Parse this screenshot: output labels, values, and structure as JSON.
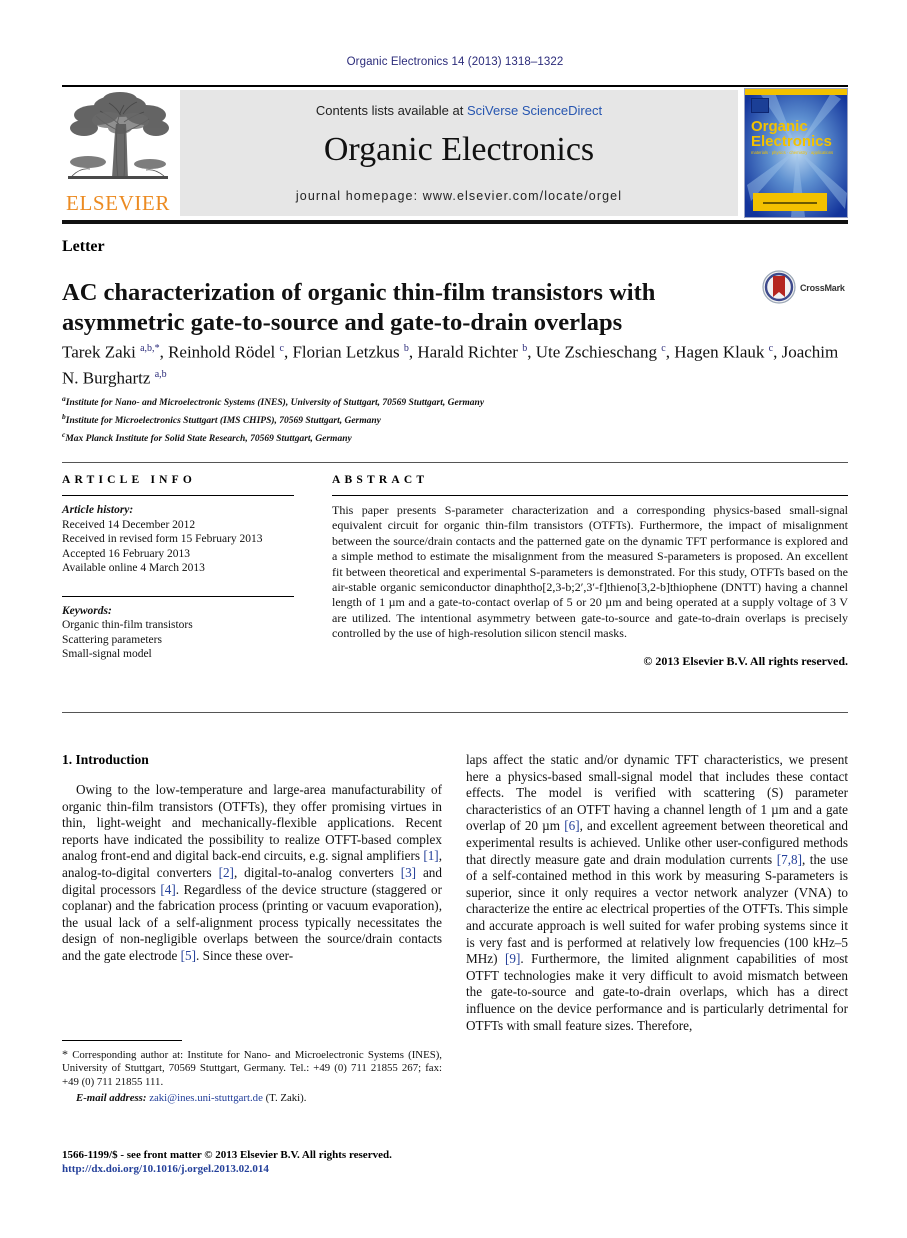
{
  "running_head": "Organic Electronics 14 (2013) 1318–1322",
  "masthead": {
    "contents_prefix": "Contents lists available at ",
    "sciencedirect_link": "SciVerse ScienceDirect",
    "journal_title": "Organic Electronics",
    "homepage_label": "journal homepage: www.elsevier.com/locate/orgel",
    "publisher_wordmark": "ELSEVIER",
    "cover": {
      "line1": "Organic",
      "line2": "Electronics",
      "tagline": "materials · physics · chemistry · applications"
    }
  },
  "article": {
    "doctype": "Letter",
    "title": "AC characterization of organic thin-film transistors with asymmetric gate-to-source and gate-to-drain overlaps",
    "crossmark_label": "CrossMark",
    "authors_html": "Tarek Zaki <sup>a,b,</sup><sup>*</sup>, Reinhold Rödel <sup>c</sup>, Florian Letzkus <sup>b</sup>, Harald Richter <sup>b</sup>, Ute Zschieschang <sup>c</sup>, Hagen Klauk <sup>c</sup>, Joachim N. Burghartz <sup>a,b</sup>",
    "affiliations": [
      {
        "marker": "a",
        "text": "Institute for Nano- and Microelectronic Systems (INES), University of Stuttgart, 70569 Stuttgart, Germany"
      },
      {
        "marker": "b",
        "text": "Institute for Microelectronics Stuttgart (IMS CHIPS), 70569 Stuttgart, Germany"
      },
      {
        "marker": "c",
        "text": "Max Planck Institute for Solid State Research, 70569 Stuttgart, Germany"
      }
    ]
  },
  "article_info": {
    "heading": "ARTICLE INFO",
    "history_label": "Article history:",
    "history": [
      "Received 14 December 2012",
      "Received in revised form 15 February 2013",
      "Accepted 16 February 2013",
      "Available online 4 March 2013"
    ],
    "keywords_label": "Keywords:",
    "keywords": [
      "Organic thin-film transistors",
      "Scattering parameters",
      "Small-signal model"
    ]
  },
  "abstract": {
    "heading": "ABSTRACT",
    "text": "This paper presents S-parameter characterization and a corresponding physics-based small-signal equivalent circuit for organic thin-film transistors (OTFTs). Furthermore, the impact of misalignment between the source/drain contacts and the patterned gate on the dynamic TFT performance is explored and a simple method to estimate the misalignment from the measured S-parameters is proposed. An excellent fit between theoretical and experimental S-parameters is demonstrated. For this study, OTFTs based on the air-stable organic semiconductor dinaphtho[2,3-b;2′,3′-f]thieno[3,2-b]thiophene (DNTT) having a channel length of 1 µm and a gate-to-contact overlap of 5 or 20 µm and being operated at a supply voltage of 3 V are utilized. The intentional asymmetry between gate-to-source and gate-to-drain overlaps is precisely controlled by the use of high-resolution silicon stencil masks.",
    "copyright": "© 2013 Elsevier B.V. All rights reserved."
  },
  "introduction": {
    "heading": "1. Introduction",
    "left_paragraph_html": "Owing to the low-temperature and large-area manufacturability of organic thin-film transistors (OTFTs), they offer promising virtues in thin, light-weight and mechanically-flexible applications. Recent reports have indicated the possibility to realize OTFT-based complex analog front-end and digital back-end circuits, e.g. signal amplifiers <span class=\"ref\">[1]</span>, analog-to-digital converters <span class=\"ref\">[2]</span>, digital-to-analog converters <span class=\"ref\">[3]</span> and digital processors <span class=\"ref\">[4]</span>. Regardless of the device structure (staggered or coplanar) and the fabrication process (printing or vacuum evaporation), the usual lack of a self-alignment process typically necessitates the design of non-negligible overlaps between the source/drain contacts and the gate electrode <span class=\"ref\">[5]</span>. Since these over-",
    "right_paragraph_html": "laps affect the static and/or dynamic TFT characteristics, we present here a physics-based small-signal model that includes these contact effects. The model is verified with scattering (S) parameter characteristics of an OTFT having a channel length of 1 µm and a gate overlap of 20 µm <span class=\"ref\">[6]</span>, and excellent agreement between theoretical and experimental results is achieved. Unlike other user-configured methods that directly measure gate and drain modulation currents <span class=\"ref\">[7,8]</span>, the use of a self-contained method in this work by measuring S-parameters is superior, since it only requires a vector network analyzer (VNA) to characterize the entire ac electrical properties of the OTFTs. This simple and accurate approach is well suited for wafer probing systems since it is very fast and is performed at relatively low frequencies (100 kHz–5 MHz) <span class=\"ref\">[9]</span>. Furthermore, the limited alignment capabilities of most OTFT technologies make it very difficult to avoid mismatch between the gate-to-source and gate-to-drain overlaps, which has a direct influence on the device performance and is particularly detrimental for OTFTs with small feature sizes. Therefore,"
  },
  "footnotes": {
    "corresponding_html": "<span style=\"font-size:12px\">*</span> Corresponding author at: Institute for Nano- and Microelectronic Systems (INES), University of Stuttgart, 70569 Stuttgart, Germany. Tel.: +49 (0) 711 21855 267; fax: +49 (0) 711 21855 111.",
    "email_label": "E-mail address:",
    "email": "zaki@ines.uni-stuttgart.de",
    "email_suffix": "(T. Zaki).",
    "issn_line": "1566-1199/$ - see front matter © 2013 Elsevier B.V. All rights reserved.",
    "doi_line": "http://dx.doi.org/10.1016/j.orgel.2013.02.014"
  }
}
